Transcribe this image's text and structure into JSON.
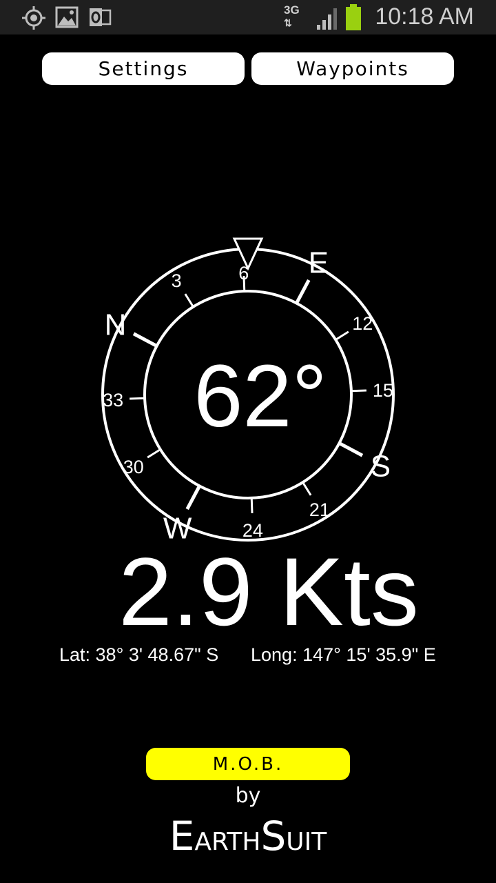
{
  "status_bar": {
    "time": "10:18 AM",
    "network": "3G",
    "icons": [
      "gps-icon",
      "gallery-icon",
      "outlook-icon",
      "signal-icon",
      "battery-icon"
    ]
  },
  "toolbar": {
    "settings_label": "Settings",
    "waypoints_label": "Waypoints"
  },
  "compass": {
    "heading_display": "62°",
    "heading_value": 62,
    "cardinals": [
      {
        "label": "N",
        "bearing": 0
      },
      {
        "label": "E",
        "bearing": 90
      },
      {
        "label": "S",
        "bearing": 180
      },
      {
        "label": "W",
        "bearing": 270
      }
    ],
    "degree_labels": [
      {
        "label": "3",
        "bearing": 30
      },
      {
        "label": "6",
        "bearing": 60
      },
      {
        "label": "12",
        "bearing": 120
      },
      {
        "label": "15",
        "bearing": 150
      },
      {
        "label": "21",
        "bearing": 210
      },
      {
        "label": "24",
        "bearing": 240
      },
      {
        "label": "30",
        "bearing": 300
      },
      {
        "label": "33",
        "bearing": 330
      }
    ]
  },
  "speed": {
    "label": "2.9 Kts"
  },
  "position": {
    "lat": "Lat: 38° 3' 48.67\" S",
    "long": "Long: 147° 15' 35.9\" E"
  },
  "mob_button": {
    "label": "M.O.B."
  },
  "footer": {
    "by": "by",
    "brand": "EarthSuit"
  },
  "colors": {
    "background": "#000000",
    "mob_button": "#ffff00",
    "button": "#ffffff"
  }
}
